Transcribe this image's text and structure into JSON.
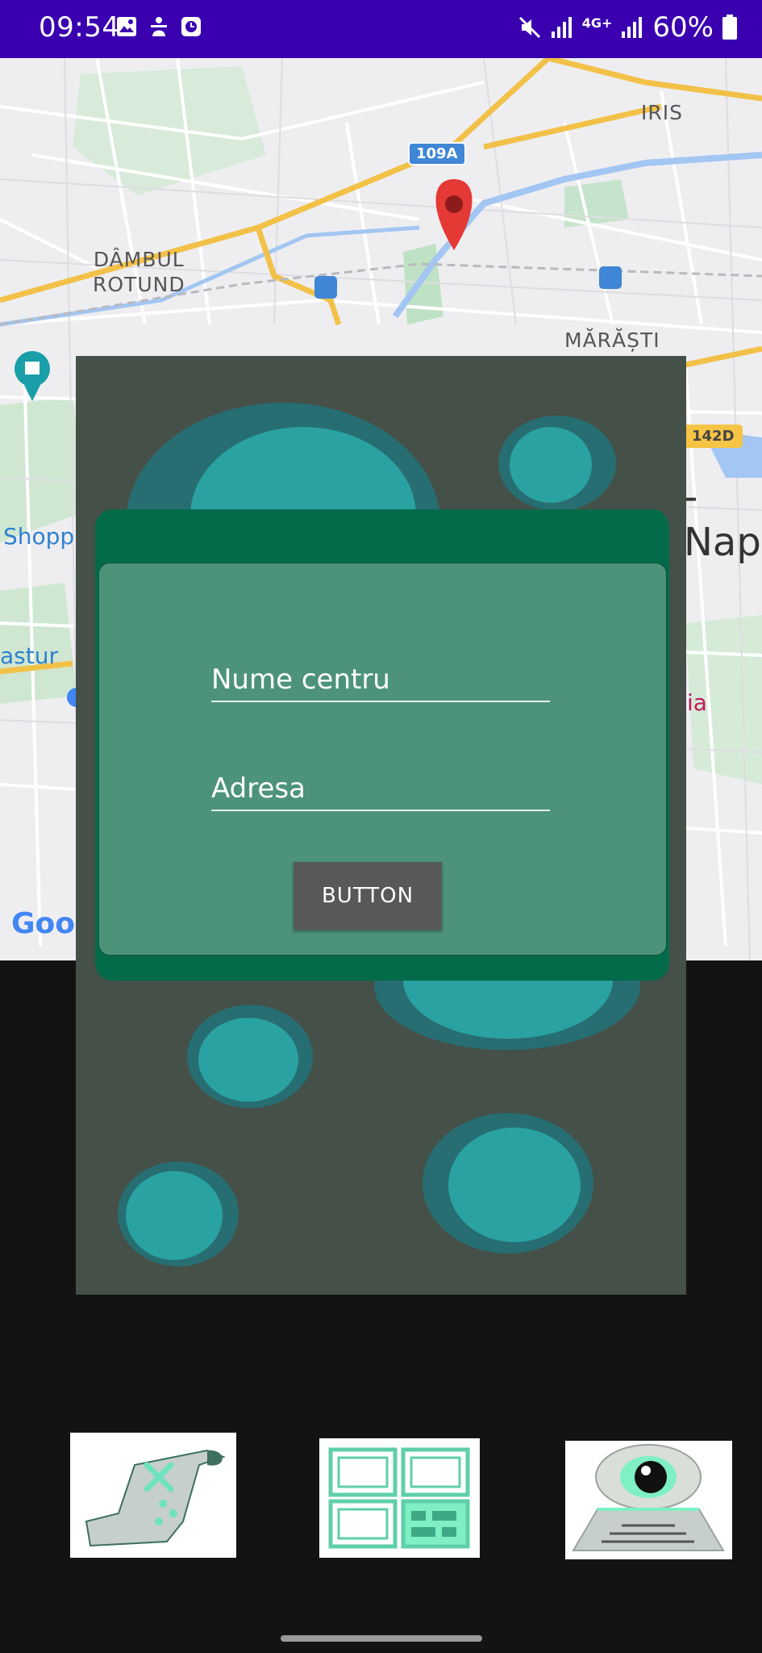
{
  "status_bar": {
    "time": "09:54",
    "network": "4G+",
    "battery": "60%",
    "left_icons": [
      "image-icon",
      "accessibility-icon",
      "clock-app-icon"
    ],
    "right_icons": [
      "mute-icon",
      "signal-icon",
      "signal-icon",
      "battery-icon"
    ]
  },
  "map": {
    "labels": {
      "iris": "IRIS",
      "dambul": "DÂMBUL\nROTUND",
      "marasti": "MĂRĂȘTI",
      "road_109a": "109A",
      "road_142d": "142D",
      "shopp": "Shopp",
      "astur": "astur",
      "nap": "-Nap",
      "ia": "ia",
      "google": "Goo"
    }
  },
  "form": {
    "name_placeholder": "Nume centru",
    "address_placeholder": "Adresa",
    "button_label": "BUTTON"
  },
  "bottom_nav": {
    "items": [
      {
        "icon": "map-scroll-icon"
      },
      {
        "icon": "dashboard-grid-icon"
      },
      {
        "icon": "eye-monitor-icon"
      }
    ]
  },
  "colors": {
    "status_bar": "#3a00b0",
    "dialog_bg": "#455049",
    "card_outer": "#046b4a",
    "card_inner": "#4c937a",
    "bubble_outer": "#276e72",
    "bubble_inner": "#2aa2a2",
    "button": "#585858"
  }
}
